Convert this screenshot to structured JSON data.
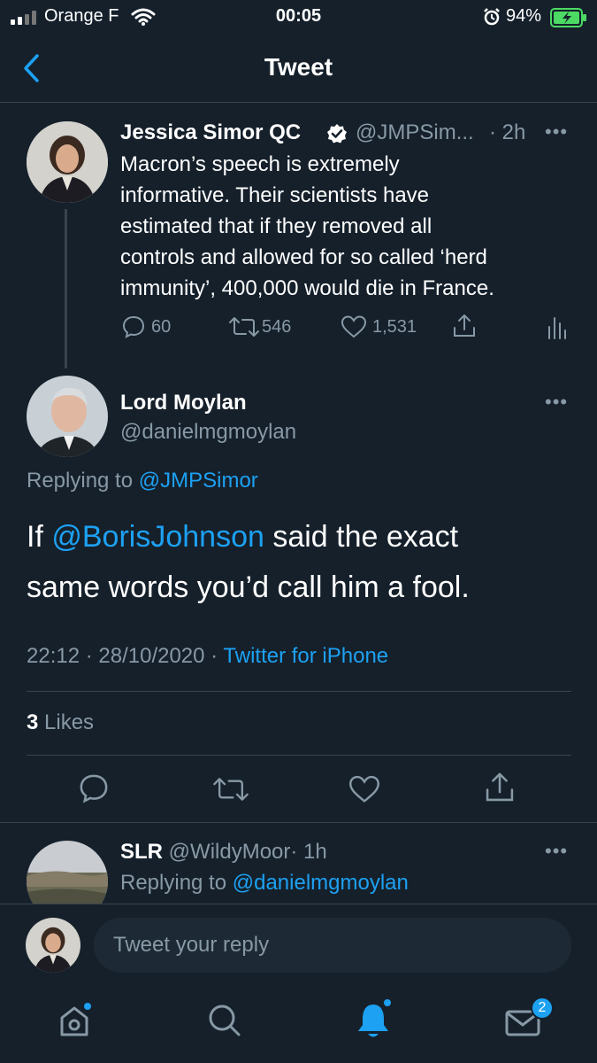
{
  "status_bar": {
    "carrier": "Orange F",
    "time": "00:05",
    "battery": "94%"
  },
  "header": {
    "title": "Tweet"
  },
  "parent_tweet": {
    "name": "Jessica Simor QC",
    "handle": "@JMPSim...",
    "time": "· 2h",
    "text_lines": [
      "Macron’s speech is extremely",
      "informative.  Their scientists have",
      "estimated that if they removed all",
      "controls and allowed for so called ‘herd",
      "immunity’, 400,000 would die in France."
    ],
    "replies": "60",
    "retweets": "546",
    "likes": "1,531"
  },
  "main_tweet": {
    "name": "Lord Moylan",
    "handle": "@danielmgmoylan",
    "replying_prefix": "Replying to",
    "replying_handle": "@JMPSimor",
    "text_line1_prefix": "If",
    "mention": "@BorisJohnson",
    "text_line1_suffix": " said the exact",
    "text_line2": "same words you’d call him a fool.",
    "timestamp": "22:12 · 28/10/2020 ·",
    "source": "Twitter for iPhone",
    "likes_count": "3",
    "likes_label": "Likes"
  },
  "reply_tweet": {
    "name": "SLR",
    "handle": "@WildyMoor",
    "time": "· 1h",
    "replying_prefix": "Replying to",
    "replying_handle": "@danielmgmoylan"
  },
  "reply_composer": {
    "placeholder": "Tweet your reply"
  },
  "tab_bar": {
    "messages_badge": "2"
  },
  "colors": {
    "background": "#15202b",
    "accent": "#1da1f2",
    "muted": "#8899a6",
    "divider": "#38444d",
    "battery": "#4cd964"
  }
}
